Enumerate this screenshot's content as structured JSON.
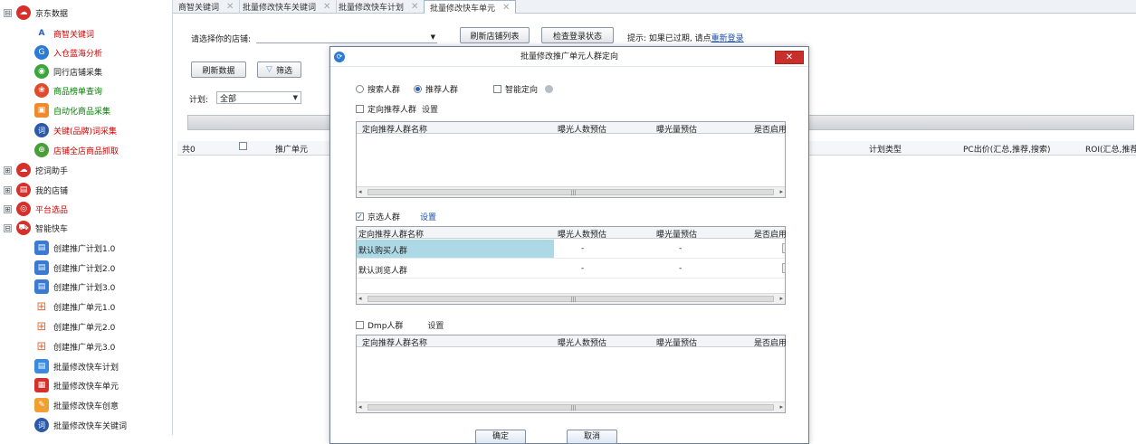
{
  "sidebar": {
    "groups": [
      {
        "label": "京东数据",
        "color": "#d4312c",
        "expander": "⊟"
      },
      {
        "label": "挖词助手",
        "color": "#d4312c",
        "expander": "⊞"
      },
      {
        "label": "我的店铺",
        "color": "#d4312c",
        "expander": "⊞"
      },
      {
        "label": "平台选品",
        "color": "#d4312c",
        "expander": "⊞"
      },
      {
        "label": "智能快车",
        "color": "#d4312c",
        "expander": "⊟"
      }
    ],
    "jd_items": [
      {
        "label": "商智关键词",
        "color": "#d00000",
        "icon": "A"
      },
      {
        "label": "入仓蓝海分析",
        "color": "#d00000",
        "icon": "G"
      },
      {
        "label": "同行店铺采集",
        "color": "#222222",
        "icon": "◉"
      },
      {
        "label": "商品榜单查询",
        "color": "#008000",
        "icon": "❀"
      },
      {
        "label": "自动化商品采集",
        "color": "#008000",
        "icon": "▣"
      },
      {
        "label": "关键(品牌)词采集",
        "color": "#d00000",
        "icon": "词"
      },
      {
        "label": "店铺全店商品抓取",
        "color": "#d00000",
        "icon": "⊕"
      }
    ],
    "kc_items": [
      {
        "label": "创建推广计划1.0",
        "icon": "▤"
      },
      {
        "label": "创建推广计划2.0",
        "icon": "▤"
      },
      {
        "label": "创建推广计划3.0",
        "icon": "▤"
      },
      {
        "label": "创建推广单元1.0",
        "icon": "⊞"
      },
      {
        "label": "创建推广单元2.0",
        "icon": "⊞"
      },
      {
        "label": "创建推广单元3.0",
        "icon": "⊞"
      },
      {
        "label": "批量修改快车计划",
        "icon": "▤"
      },
      {
        "label": "批量修改快车单元",
        "icon": "▦"
      },
      {
        "label": "批量修改快车创意",
        "icon": "✎"
      },
      {
        "label": "批量修改快车关键词",
        "icon": "词"
      }
    ]
  },
  "tabs": [
    {
      "label": "商智关键词",
      "close": "✕"
    },
    {
      "label": "批量修改快车关键词",
      "close": "✕"
    },
    {
      "label": "批量修改快车计划",
      "close": "✕"
    },
    {
      "label": "批量修改快车单元",
      "close": "✕"
    }
  ],
  "main": {
    "shop_label": "请选择你的店铺:",
    "refresh_shops": "刷新店铺列表",
    "check_login": "检查登录状态",
    "hint_prefix": "提示: 如果已过期, 请点",
    "hint_link": "重新登录",
    "refresh_data": "刷新数据",
    "filter": "筛选",
    "plan_label": "计划:",
    "plan_value": "全部",
    "grid_cols": [
      "共0",
      "推广单元",
      "计划类型",
      "PC出价(汇总,推荐,搜索)",
      "ROI(汇总,推荐"
    ]
  },
  "modal": {
    "title": "批量修改推广单元人群定向",
    "close": "✕",
    "radio_search": "搜索人群",
    "radio_recommend": "推荐人群",
    "smart_target": "智能定向",
    "section1_label": "定向推荐人群",
    "section1_link": "设置",
    "section2_label": "京选人群",
    "section2_link": "设置",
    "section3_label": "Dmp人群",
    "section3_link": "设置",
    "cols": [
      "定向推荐人群名称",
      "曝光人数预估",
      "曝光量预估",
      "是否启用"
    ],
    "rows": [
      {
        "name": "默认购买人群",
        "a": "-",
        "b": "-"
      },
      {
        "name": "默认浏览人群",
        "a": "-",
        "b": "-"
      }
    ],
    "ok": "确定",
    "cancel": "取消"
  }
}
